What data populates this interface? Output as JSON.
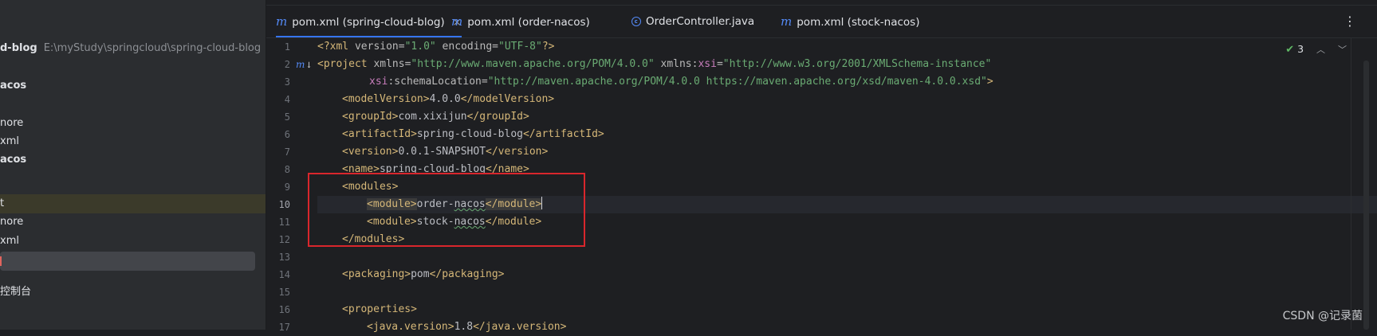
{
  "sidebar": {
    "project_name": "d-blog",
    "project_path": "E:\\myStudy\\springcloud\\spring-cloud-blog",
    "items": [
      {
        "label": "acos",
        "bold": true
      },
      {
        "label": "nore",
        "bold": false
      },
      {
        "label": "xml",
        "bold": false
      },
      {
        "label": "acos",
        "bold": true
      },
      {
        "label": "t",
        "bold": false
      },
      {
        "label": "nore",
        "bold": false
      },
      {
        "label": "xml",
        "bold": false
      },
      {
        "label": "",
        "bold": false
      },
      {
        "label": "控制台",
        "bold": false
      }
    ]
  },
  "tabs": [
    {
      "label": "pom.xml (spring-cloud-blog)",
      "icon": "maven-m-icon",
      "active": true,
      "closable": true
    },
    {
      "label": "pom.xml (order-nacos)",
      "icon": "maven-m-icon",
      "active": false
    },
    {
      "label": "OrderController.java",
      "icon": "java-class-icon",
      "active": false
    },
    {
      "label": "pom.xml (stock-nacos)",
      "icon": "maven-m-icon",
      "active": false
    }
  ],
  "tab_close_glyph": "×",
  "more_glyph": "⋮",
  "inspection": {
    "count": "3"
  },
  "line_numbers": [
    "1",
    "2",
    "3",
    "4",
    "5",
    "6",
    "7",
    "8",
    "9",
    "10",
    "11",
    "12",
    "13",
    "14",
    "15",
    "16",
    "17"
  ],
  "current_line": "10",
  "code": {
    "l1": {
      "a": "<?xml ",
      "b": "version=",
      "c": "\"1.0\"",
      "d": " encoding=",
      "e": "\"UTF-8\"",
      "f": "?>"
    },
    "l2": {
      "a": "<project ",
      "b": "xmlns=",
      "c": "\"http://www.maven.apache.org/POM/4.0.0\"",
      "d": " xmlns:",
      "e": "xsi",
      "f": "=",
      "g": "\"http://www.w3.org/2001/XMLSchema-instance\""
    },
    "l3": {
      "a": "xsi",
      "b": ":schemaLocation=",
      "c": "\"http://maven.apache.org/POM/4.0.0 https://maven.apache.org/xsd/maven-4.0.0.xsd\"",
      "d": ">"
    },
    "l4": {
      "open": "<modelVersion>",
      "text": "4.0.0",
      "close": "</modelVersion>"
    },
    "l5": {
      "open": "<groupId>",
      "text": "com.xixijun",
      "close": "</groupId>"
    },
    "l6": {
      "open": "<artifactId>",
      "text": "spring-cloud-blog",
      "close": "</artifactId>"
    },
    "l7": {
      "open": "<version>",
      "text": "0.0.1-SNAPSHOT",
      "close": "</version>"
    },
    "l8": {
      "open": "<name>",
      "text": "spring-cloud-blog",
      "close": "</name>"
    },
    "l9": {
      "open": "<modules>"
    },
    "l10": {
      "open": "<module>",
      "text1": "order-",
      "text2": "nacos",
      "close": "</module>"
    },
    "l11": {
      "open": "<module>",
      "text1": "stock-",
      "text2": "nacos",
      "close": "</module>"
    },
    "l12": {
      "close": "</modules>"
    },
    "l14": {
      "open": "<packaging>",
      "text": "pom",
      "close": "</packaging>"
    },
    "l16": {
      "open": "<properties>"
    },
    "l17": {
      "open": "<java.version>",
      "text": "1.8",
      "close": "</java.version>"
    }
  },
  "watermark": "CSDN @记录菌",
  "colors": {
    "tag": "#d5b778",
    "string": "#6aab73",
    "namespace": "#c77dbb",
    "accent": "#3574f0",
    "annotation_box": "#d9262c"
  }
}
